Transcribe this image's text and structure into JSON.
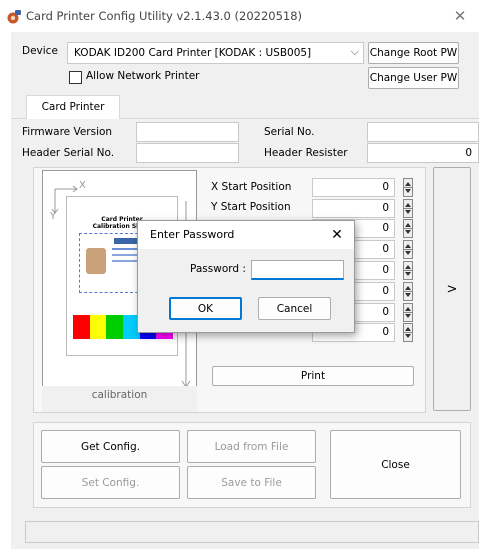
{
  "window": {
    "title": "Card Printer Config Utility v2.1.43.0 (20220518)",
    "close_glyph": "✕"
  },
  "device": {
    "label": "Device",
    "selected": "KODAK ID200 Card Printer  [KODAK : USB005]",
    "allow_network_label": "Allow Network Printer",
    "allow_network_checked": false,
    "change_root_pw": "Change Root PW",
    "change_user_pw": "Change User PW"
  },
  "tabs": [
    {
      "label": "Card Printer",
      "active": true
    }
  ],
  "info": {
    "firmware_label": "Firmware Version",
    "firmware_value": "",
    "serial_label": "Serial No.",
    "serial_value": "",
    "header_serial_label": "Header Serial No.",
    "header_serial_value": "",
    "header_resister_label": "Header Resister",
    "header_resister_value": "0"
  },
  "positions": [
    {
      "label": "X Start Position",
      "value": "0"
    },
    {
      "label": "Y Start Position",
      "value": "0"
    },
    {
      "label": "",
      "value": "0"
    },
    {
      "label": "",
      "value": "0"
    },
    {
      "label": "",
      "value": "0"
    },
    {
      "label": "",
      "value": "0"
    },
    {
      "label": "",
      "value": "0"
    },
    {
      "label": "",
      "value": "0"
    }
  ],
  "preview": {
    "caption": "calibration",
    "card_title": "Card Printer",
    "card_subtitle": "Calibration Sheet",
    "x_axis_glyph": "X",
    "y_axis_glyph": "Y",
    "color_bars": [
      "#ff0000",
      "#ffff00",
      "#00cc00",
      "#00ccff",
      "#0000ff",
      "#ff00ff"
    ]
  },
  "print_button": "Print",
  "next_button": ">",
  "actions": {
    "get_config": "Get Config.",
    "load_from_file": "Load from File",
    "set_config": "Set Config.",
    "save_to_file": "Save to File",
    "close": "Close"
  },
  "modal": {
    "title": "Enter Password",
    "close_glyph": "✕",
    "password_label": "Password :",
    "password_value": "",
    "ok": "OK",
    "cancel": "Cancel"
  },
  "colors": {
    "accent": "#0078d7",
    "dialog_bg": "#f0f0f0",
    "disabled_text": "#9a9a9a"
  }
}
